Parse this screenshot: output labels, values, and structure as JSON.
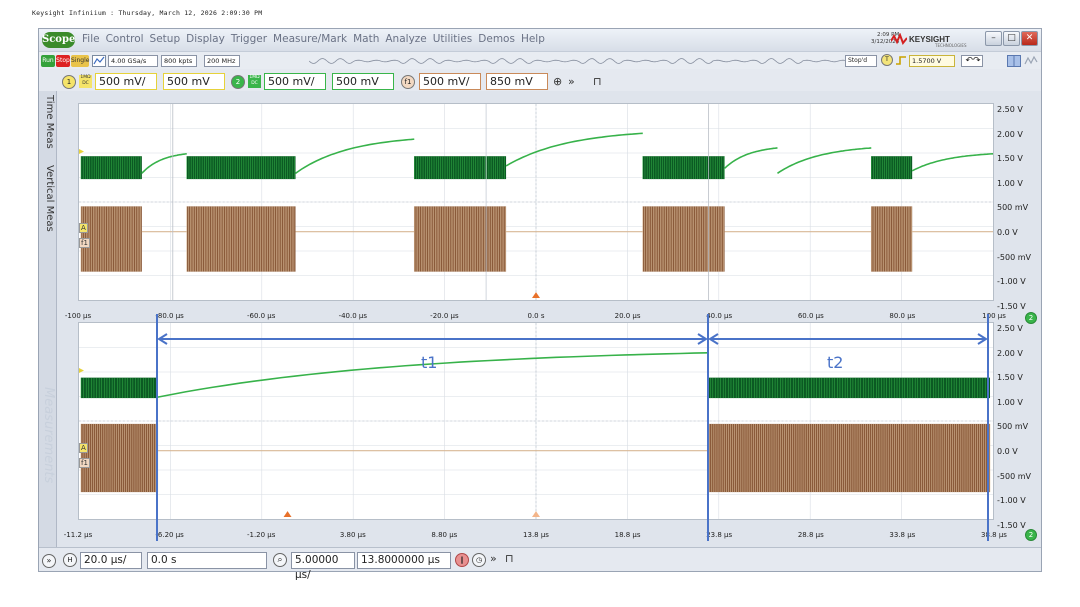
{
  "caption": "Keysight Infiniium : Thursday, March 12, 2026 2:09:30 PM",
  "menubar": {
    "logo": "Scope",
    "items": [
      "File",
      "Control",
      "Setup",
      "Display",
      "Trigger",
      "Measure/Mark",
      "Math",
      "Analyze",
      "Utilities",
      "Demos",
      "Help"
    ],
    "time": "2:09 PM",
    "date": "3/12/2026",
    "brand": "KEYSIGHT",
    "brand_sub": "TECHNOLOGIES",
    "window_buttons": [
      "minimize-icon",
      "maximize-icon",
      "close-icon"
    ]
  },
  "toolbar1": {
    "run": "Run",
    "stop": "Stop",
    "single": "Single",
    "sample_rate": "4.00 GSa/s",
    "memory": "800 kpts",
    "bandwidth": "200 MHz",
    "stop_status": "Stop'd",
    "trigger_source": "T",
    "trigger_level": "1.5700 V"
  },
  "channels": [
    {
      "id": "1",
      "coupling": "1MΩ DC",
      "scale": "500 mV/",
      "offset": "500 mV",
      "color": "#e6d23a"
    },
    {
      "id": "2",
      "coupling": "1MΩ DC",
      "scale": "500 mV/",
      "offset": "500 mV",
      "color": "#39b54a"
    },
    {
      "id": "f1",
      "coupling": "",
      "scale": "500 mV/",
      "offset": "850 mV",
      "color": "#c98a5a"
    }
  ],
  "sidebar": {
    "tabs": [
      "Time Meas",
      "Vertical Meas"
    ],
    "watermark": "Measurements"
  },
  "upper_plot": {
    "y_labels": [
      "2.50 V",
      "2.00 V",
      "1.50 V",
      "1.00 V",
      "500 mV",
      "0.0 V",
      "-500 mV",
      "-1.00 V",
      "-1.50 V"
    ],
    "x_labels": [
      "-100 µs",
      "-80.0 µs",
      "-60.0 µs",
      "-40.0 µs",
      "-20.0 µs",
      "0.0 s",
      "20.0 µs",
      "40.0 µs",
      "60.0 µs",
      "80.0 µs",
      "100 µs"
    ],
    "channel_badge": "2"
  },
  "lower_plot": {
    "y_labels": [
      "2.50 V",
      "2.00 V",
      "1.50 V",
      "1.00 V",
      "500 mV",
      "0.0 V",
      "-500 mV",
      "-1.00 V",
      "-1.50 V"
    ],
    "x_labels": [
      "-11.2 µs",
      "-6.20 µs",
      "-1.20 µs",
      "3.80 µs",
      "8.80 µs",
      "13.8 µs",
      "18.8 µs",
      "23.8 µs",
      "28.8 µs",
      "33.8 µs",
      "38.8 µs"
    ],
    "channel_badge": "2",
    "annotations": {
      "t1": "t1",
      "t2": "t2"
    },
    "marker_A": "A",
    "marker_f1": "f1"
  },
  "bottombar": {
    "h_label": "H",
    "h_scale": "20.0 µs/",
    "h_position": "0.0 s",
    "zoom_scale": "5.00000 µs/",
    "zoom_position": "13.8000000 µs"
  },
  "colors": {
    "ch1": "#e6d23a",
    "ch2_dark": "#0b5a23",
    "ch2_light": "#37b24a",
    "math": "#8a5a3a",
    "math_light": "#d8b896",
    "annotation": "#4a73c8",
    "badge_green": "#39b54a"
  }
}
